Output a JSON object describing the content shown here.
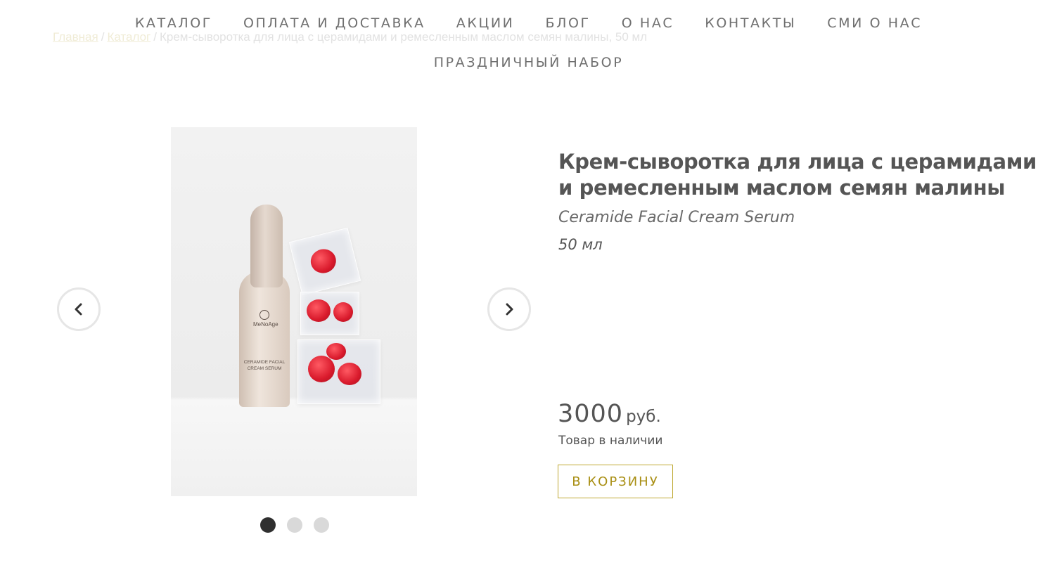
{
  "breadcrumb": {
    "home": "Главная",
    "catalog": "Каталог",
    "separator": "/",
    "current": "Крем-сыворотка для лица с церамидами и ремесленным маслом семян малины, 50 мл"
  },
  "nav": {
    "items": [
      "КАТАЛОГ",
      "ОПЛАТА И ДОСТАВКА",
      "АКЦИИ",
      "БЛОГ",
      "О НАС",
      "КОНТАКТЫ",
      "СМИ О НАС",
      "ПРАЗДНИЧНЫЙ НАБОР"
    ]
  },
  "gallery": {
    "bottle_brand": "MeNoAge",
    "bottle_label": "CERAMIDE FACIAL CREAM SERUM",
    "slides_total": 3,
    "active_slide": 1,
    "prev_icon": "chevron-left-icon",
    "next_icon": "chevron-right-icon"
  },
  "product": {
    "title": "Крем-сыворотка для лица с церамидами и ремесленным маслом семян малины",
    "subtitle": "Ceramide Facial Cream Serum",
    "volume": "50 мл",
    "price": "3000",
    "currency": "руб.",
    "stock": "Товар в наличии",
    "cart_label": "В КОРЗИНУ"
  },
  "colors": {
    "accent": "#bfa832",
    "text": "#555555",
    "nav_text": "#6f6f6f",
    "dot_active": "#2f2f2f",
    "dot_inactive": "#d9d9d9"
  }
}
